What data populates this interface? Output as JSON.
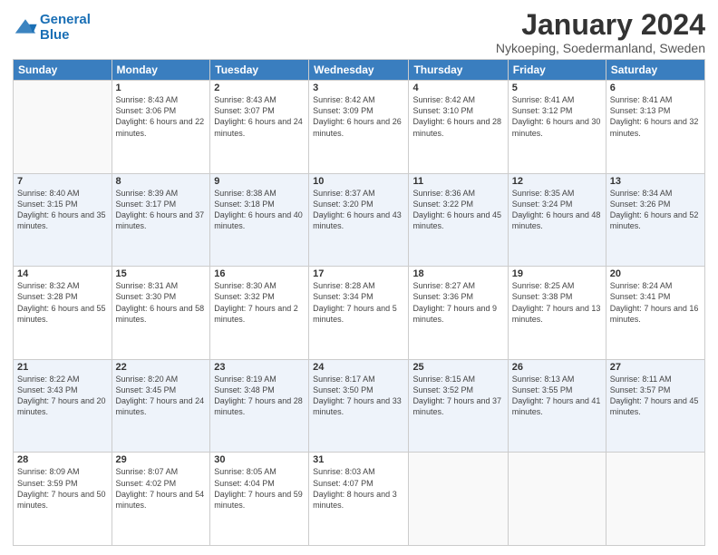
{
  "header": {
    "logo_general": "General",
    "logo_blue": "Blue",
    "month_title": "January 2024",
    "subtitle": "Nykoeping, Soedermanland, Sweden"
  },
  "days_of_week": [
    "Sunday",
    "Monday",
    "Tuesday",
    "Wednesday",
    "Thursday",
    "Friday",
    "Saturday"
  ],
  "weeks": [
    [
      {
        "day": "",
        "sunrise": "",
        "sunset": "",
        "daylight": ""
      },
      {
        "day": "1",
        "sunrise": "Sunrise: 8:43 AM",
        "sunset": "Sunset: 3:06 PM",
        "daylight": "Daylight: 6 hours and 22 minutes."
      },
      {
        "day": "2",
        "sunrise": "Sunrise: 8:43 AM",
        "sunset": "Sunset: 3:07 PM",
        "daylight": "Daylight: 6 hours and 24 minutes."
      },
      {
        "day": "3",
        "sunrise": "Sunrise: 8:42 AM",
        "sunset": "Sunset: 3:09 PM",
        "daylight": "Daylight: 6 hours and 26 minutes."
      },
      {
        "day": "4",
        "sunrise": "Sunrise: 8:42 AM",
        "sunset": "Sunset: 3:10 PM",
        "daylight": "Daylight: 6 hours and 28 minutes."
      },
      {
        "day": "5",
        "sunrise": "Sunrise: 8:41 AM",
        "sunset": "Sunset: 3:12 PM",
        "daylight": "Daylight: 6 hours and 30 minutes."
      },
      {
        "day": "6",
        "sunrise": "Sunrise: 8:41 AM",
        "sunset": "Sunset: 3:13 PM",
        "daylight": "Daylight: 6 hours and 32 minutes."
      }
    ],
    [
      {
        "day": "7",
        "sunrise": "Sunrise: 8:40 AM",
        "sunset": "Sunset: 3:15 PM",
        "daylight": "Daylight: 6 hours and 35 minutes."
      },
      {
        "day": "8",
        "sunrise": "Sunrise: 8:39 AM",
        "sunset": "Sunset: 3:17 PM",
        "daylight": "Daylight: 6 hours and 37 minutes."
      },
      {
        "day": "9",
        "sunrise": "Sunrise: 8:38 AM",
        "sunset": "Sunset: 3:18 PM",
        "daylight": "Daylight: 6 hours and 40 minutes."
      },
      {
        "day": "10",
        "sunrise": "Sunrise: 8:37 AM",
        "sunset": "Sunset: 3:20 PM",
        "daylight": "Daylight: 6 hours and 43 minutes."
      },
      {
        "day": "11",
        "sunrise": "Sunrise: 8:36 AM",
        "sunset": "Sunset: 3:22 PM",
        "daylight": "Daylight: 6 hours and 45 minutes."
      },
      {
        "day": "12",
        "sunrise": "Sunrise: 8:35 AM",
        "sunset": "Sunset: 3:24 PM",
        "daylight": "Daylight: 6 hours and 48 minutes."
      },
      {
        "day": "13",
        "sunrise": "Sunrise: 8:34 AM",
        "sunset": "Sunset: 3:26 PM",
        "daylight": "Daylight: 6 hours and 52 minutes."
      }
    ],
    [
      {
        "day": "14",
        "sunrise": "Sunrise: 8:32 AM",
        "sunset": "Sunset: 3:28 PM",
        "daylight": "Daylight: 6 hours and 55 minutes."
      },
      {
        "day": "15",
        "sunrise": "Sunrise: 8:31 AM",
        "sunset": "Sunset: 3:30 PM",
        "daylight": "Daylight: 6 hours and 58 minutes."
      },
      {
        "day": "16",
        "sunrise": "Sunrise: 8:30 AM",
        "sunset": "Sunset: 3:32 PM",
        "daylight": "Daylight: 7 hours and 2 minutes."
      },
      {
        "day": "17",
        "sunrise": "Sunrise: 8:28 AM",
        "sunset": "Sunset: 3:34 PM",
        "daylight": "Daylight: 7 hours and 5 minutes."
      },
      {
        "day": "18",
        "sunrise": "Sunrise: 8:27 AM",
        "sunset": "Sunset: 3:36 PM",
        "daylight": "Daylight: 7 hours and 9 minutes."
      },
      {
        "day": "19",
        "sunrise": "Sunrise: 8:25 AM",
        "sunset": "Sunset: 3:38 PM",
        "daylight": "Daylight: 7 hours and 13 minutes."
      },
      {
        "day": "20",
        "sunrise": "Sunrise: 8:24 AM",
        "sunset": "Sunset: 3:41 PM",
        "daylight": "Daylight: 7 hours and 16 minutes."
      }
    ],
    [
      {
        "day": "21",
        "sunrise": "Sunrise: 8:22 AM",
        "sunset": "Sunset: 3:43 PM",
        "daylight": "Daylight: 7 hours and 20 minutes."
      },
      {
        "day": "22",
        "sunrise": "Sunrise: 8:20 AM",
        "sunset": "Sunset: 3:45 PM",
        "daylight": "Daylight: 7 hours and 24 minutes."
      },
      {
        "day": "23",
        "sunrise": "Sunrise: 8:19 AM",
        "sunset": "Sunset: 3:48 PM",
        "daylight": "Daylight: 7 hours and 28 minutes."
      },
      {
        "day": "24",
        "sunrise": "Sunrise: 8:17 AM",
        "sunset": "Sunset: 3:50 PM",
        "daylight": "Daylight: 7 hours and 33 minutes."
      },
      {
        "day": "25",
        "sunrise": "Sunrise: 8:15 AM",
        "sunset": "Sunset: 3:52 PM",
        "daylight": "Daylight: 7 hours and 37 minutes."
      },
      {
        "day": "26",
        "sunrise": "Sunrise: 8:13 AM",
        "sunset": "Sunset: 3:55 PM",
        "daylight": "Daylight: 7 hours and 41 minutes."
      },
      {
        "day": "27",
        "sunrise": "Sunrise: 8:11 AM",
        "sunset": "Sunset: 3:57 PM",
        "daylight": "Daylight: 7 hours and 45 minutes."
      }
    ],
    [
      {
        "day": "28",
        "sunrise": "Sunrise: 8:09 AM",
        "sunset": "Sunset: 3:59 PM",
        "daylight": "Daylight: 7 hours and 50 minutes."
      },
      {
        "day": "29",
        "sunrise": "Sunrise: 8:07 AM",
        "sunset": "Sunset: 4:02 PM",
        "daylight": "Daylight: 7 hours and 54 minutes."
      },
      {
        "day": "30",
        "sunrise": "Sunrise: 8:05 AM",
        "sunset": "Sunset: 4:04 PM",
        "daylight": "Daylight: 7 hours and 59 minutes."
      },
      {
        "day": "31",
        "sunrise": "Sunrise: 8:03 AM",
        "sunset": "Sunset: 4:07 PM",
        "daylight": "Daylight: 8 hours and 3 minutes."
      },
      {
        "day": "",
        "sunrise": "",
        "sunset": "",
        "daylight": ""
      },
      {
        "day": "",
        "sunrise": "",
        "sunset": "",
        "daylight": ""
      },
      {
        "day": "",
        "sunrise": "",
        "sunset": "",
        "daylight": ""
      }
    ]
  ]
}
